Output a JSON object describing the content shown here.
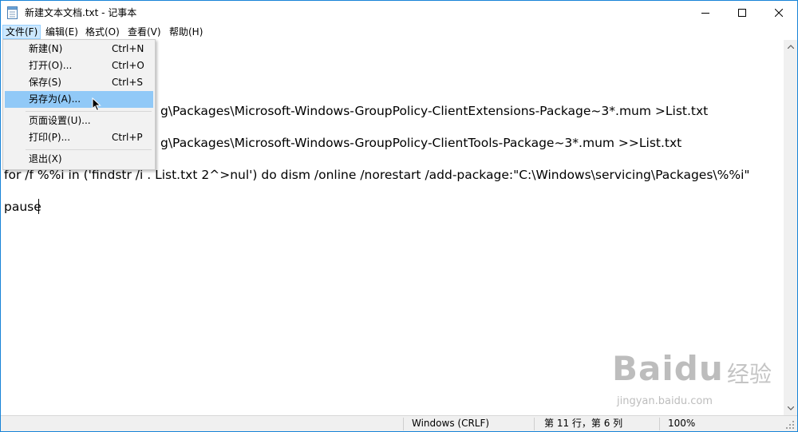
{
  "window": {
    "title": "新建文本文档.txt - 记事本"
  },
  "menubar": [
    "文件(F)",
    "编辑(E)",
    "格式(O)",
    "查看(V)",
    "帮助(H)"
  ],
  "file_menu": {
    "items": [
      {
        "label": "新建(N)",
        "shortcut": "Ctrl+N"
      },
      {
        "label": "打开(O)...",
        "shortcut": "Ctrl+O"
      },
      {
        "label": "保存(S)",
        "shortcut": "Ctrl+S"
      },
      {
        "label": "另存为(A)...",
        "shortcut": ""
      },
      {
        "label": "页面设置(U)...",
        "shortcut": ""
      },
      {
        "label": "打印(P)...",
        "shortcut": "Ctrl+P"
      },
      {
        "label": "退出(X)",
        "shortcut": ""
      }
    ],
    "hovered": "另存为(A)..."
  },
  "editor": {
    "lines": [
      "g\\Packages\\Microsoft-Windows-GroupPolicy-ClientExtensions-Package~3*.mum >List.txt",
      "g\\Packages\\Microsoft-Windows-GroupPolicy-ClientTools-Package~3*.mum >>List.txt",
      "for /f %%i in ('findstr /i . List.txt 2^>nul') do dism /online /norestart /add-package:\"C:\\Windows\\servicing\\Packages\\%%i\"",
      "pause"
    ]
  },
  "statusbar": {
    "encoding": "Windows (CRLF)",
    "position": "第 11 行，第 6 列",
    "zoom": "100%"
  },
  "watermark": {
    "brand": "Baidu",
    "brand_cn": "经验",
    "url": "jingyan.baidu.com"
  }
}
